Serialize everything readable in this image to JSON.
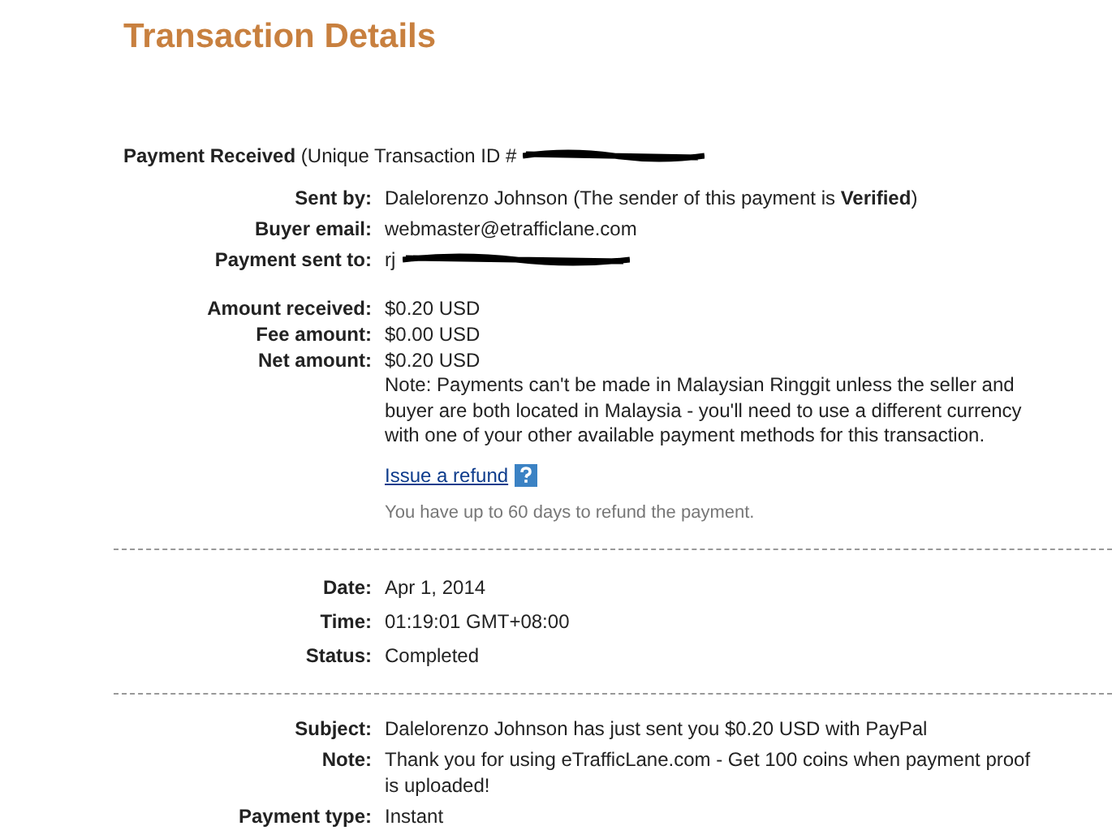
{
  "title": "Transaction Details",
  "header": {
    "label": "Payment Received",
    "text": "(Unique Transaction ID #",
    "redacted": true
  },
  "sections": [
    {
      "groups": [
        {
          "rows": [
            {
              "label": "Sent by:",
              "value": "Dalelorenzo Johnson (The sender of this payment is **Verified**)",
              "redacted": false
            },
            {
              "label": "Buyer email:",
              "value": "webmaster@etrafficlane.com",
              "redacted": false
            },
            {
              "label": "Payment sent to:",
              "value": "rj",
              "redacted": true
            }
          ]
        },
        {
          "rows": [
            {
              "label": "Amount received:",
              "value": "$0.20 USD",
              "redacted": false
            },
            {
              "label": "Fee amount:",
              "value": "$0.00 USD",
              "redacted": false
            },
            {
              "label": "Net amount:",
              "value": "$0.20 USD",
              "redacted": false,
              "note": "Note: Payments can't be made in Malaysian Ringgit unless the seller and buyer are both located in Malaysia - you'll need to use a different currency with one of your other available payment methods for this transaction.",
              "link": "Issue a refund",
              "hint": "You have up to 60 days to refund the payment."
            }
          ]
        }
      ]
    },
    {
      "groups": [
        {
          "rows": [
            {
              "label": "Date:",
              "value": "Apr 1, 2014",
              "redacted": false
            },
            {
              "label": "Time:",
              "value": "01:19:01 GMT+08:00",
              "redacted": false
            },
            {
              "label": "Status:",
              "value": "Completed",
              "redacted": false
            }
          ]
        }
      ]
    },
    {
      "groups": [
        {
          "rows": [
            {
              "label": "Subject:",
              "value": "Dalelorenzo Johnson has just sent you $0.20 USD with PayPal",
              "redacted": false
            },
            {
              "label": "Note:",
              "value": "Thank you for using eTrafficLane.com - Get 100 coins when payment proof is uploaded!",
              "redacted": false
            },
            {
              "label": "Payment type:",
              "value": "Instant",
              "redacted": false
            }
          ]
        }
      ]
    }
  ]
}
